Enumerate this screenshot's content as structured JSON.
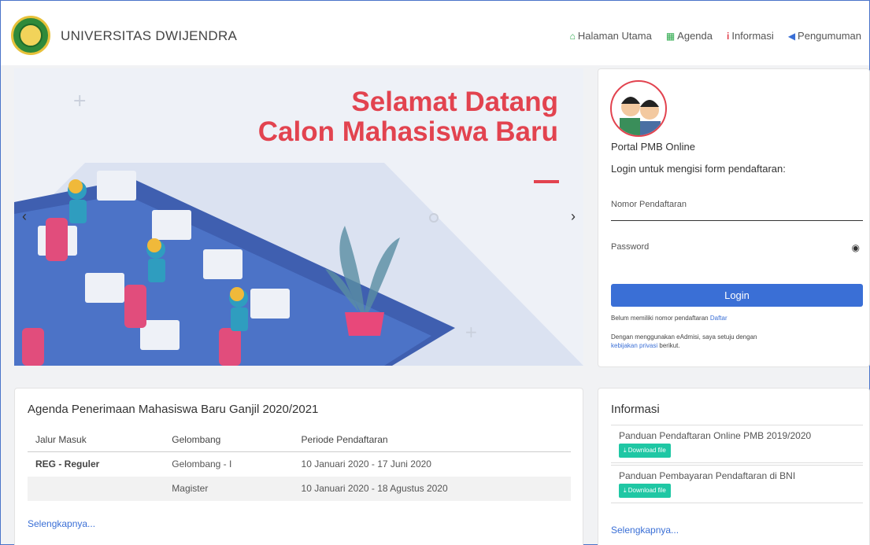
{
  "header": {
    "brand": "UNIVERSITAS DWIJENDRA",
    "nav": [
      {
        "icon": "home-icon",
        "label": "Halaman Utama",
        "color": "#2aa84a"
      },
      {
        "icon": "calendar-icon",
        "label": "Agenda",
        "color": "#2aa84a"
      },
      {
        "icon": "info-icon",
        "label": "Informasi",
        "color": "#e2434f"
      },
      {
        "icon": "megaphone-icon",
        "label": "Pengumuman",
        "color": "#3a6fd6"
      }
    ]
  },
  "hero": {
    "line1": "Selamat Datang",
    "line2": "Calon Mahasiswa Baru",
    "prev": "‹",
    "next": "›"
  },
  "login": {
    "portal": "Portal PMB Online",
    "hint": "Login untuk mengisi form pendaftaran:",
    "nomor_label": "Nomor Pendaftaran",
    "password_label": "Password",
    "button": "Login",
    "no_account": "Belum memiliki nomor pendaftaran",
    "register": "Daftar",
    "agree": "Dengan menggunakan eAdmisi, saya setuju dengan",
    "privacy": "kebijakan privasi",
    "after": "berikut."
  },
  "agenda": {
    "title": "Agenda Penerimaan Mahasiswa Baru Ganjil 2020/2021",
    "headers": [
      "Jalur Masuk",
      "Gelombang",
      "Periode Pendaftaran"
    ],
    "rows": [
      [
        "REG - Reguler",
        "Gelombang - I",
        "10 Januari 2020 - 17 Juni 2020"
      ],
      [
        "",
        "Magister",
        "10 Januari 2020 - 18 Agustus 2020"
      ]
    ],
    "more": "Selengkapnya..."
  },
  "informasi": {
    "title": "Informasi",
    "items": [
      {
        "title": "Panduan Pendaftaran Online PMB 2019/2020",
        "button": "Download file"
      },
      {
        "title": "Panduan Pembayaran Pendaftaran di BNI",
        "button": "Download file"
      }
    ],
    "more": "Selengkapnya..."
  }
}
